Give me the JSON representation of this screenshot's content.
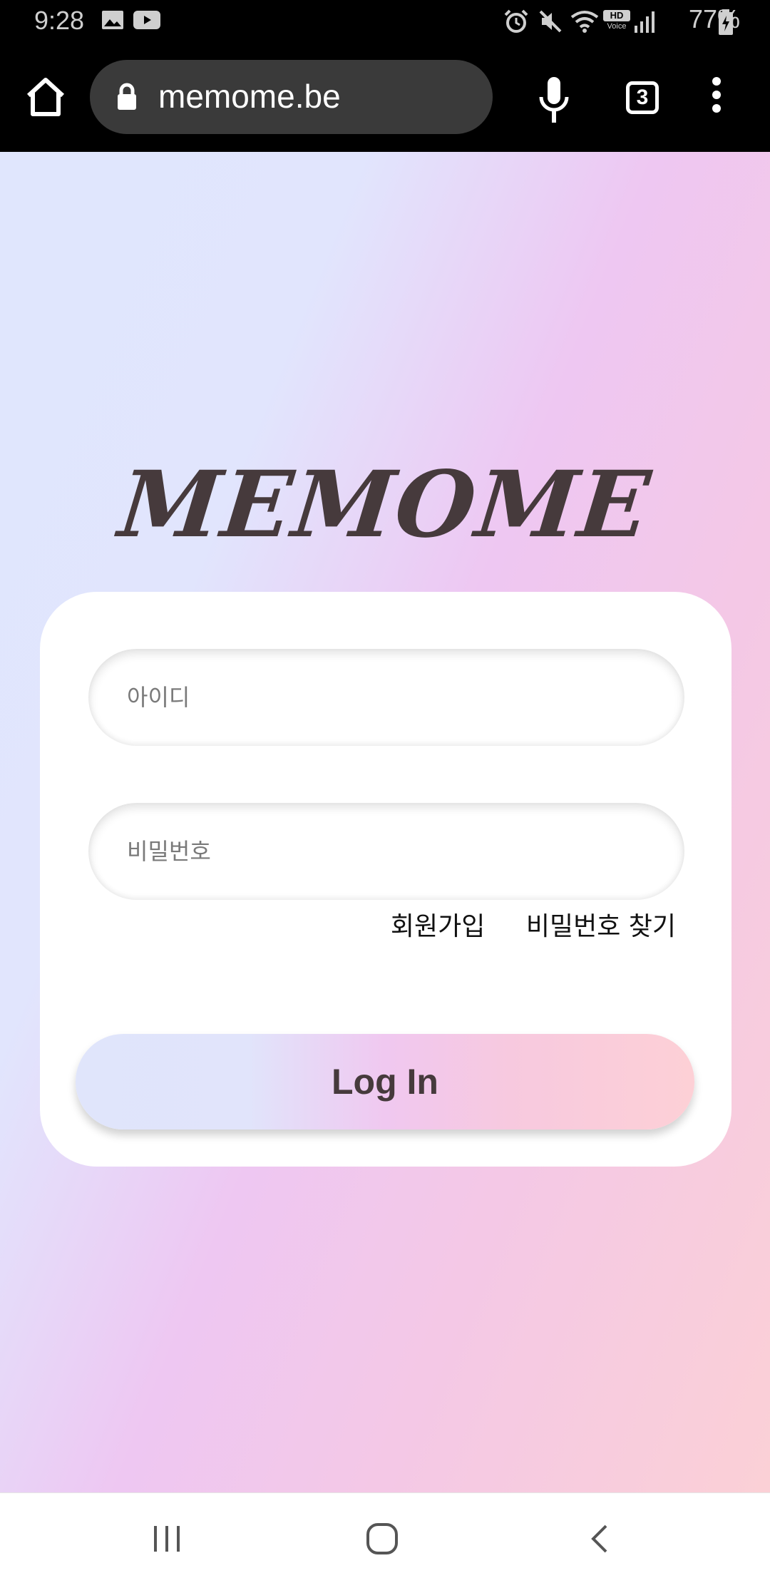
{
  "status_bar": {
    "time": "9:28",
    "battery": "77%",
    "icons": [
      "gallery-icon",
      "youtube-icon",
      "alarm-icon",
      "mute-icon",
      "wifi-icon",
      "hd-voice-icon",
      "signal-icon",
      "battery-icon"
    ],
    "hd_label": "HD",
    "voice_label": "Voice"
  },
  "browser": {
    "url": "memome.be",
    "tab_count": "3",
    "icons": [
      "home-icon",
      "lock-icon",
      "mic-icon",
      "tabs-icon",
      "menu-icon"
    ]
  },
  "login": {
    "logo": "MEMOME",
    "id_placeholder": "아이디",
    "password_placeholder": "비밀번호",
    "signup_link": "회원가입",
    "find_password_link": "비밀번호 찾기",
    "login_button": "Log In",
    "colors": {
      "logo": "#463a3c",
      "gradient_start": "#e0e6fd",
      "gradient_mid": "#eec7f2",
      "gradient_end": "#fbd0d6"
    }
  },
  "nav_bar": {
    "icons": [
      "recents-icon",
      "home-nav-icon",
      "back-icon"
    ]
  }
}
